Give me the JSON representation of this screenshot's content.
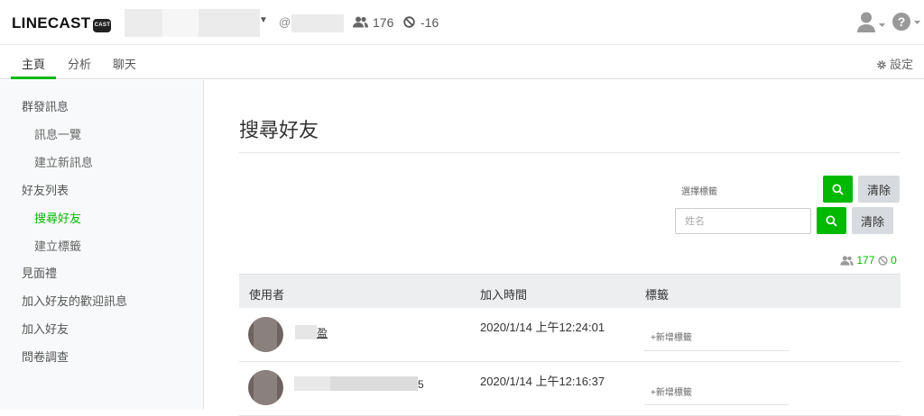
{
  "header": {
    "logo": "LINECAST",
    "logo_badge": "CAST",
    "account_at": "@",
    "friends_count": "176",
    "blocked_count": "-16"
  },
  "tabs": [
    {
      "label": "主頁",
      "active": true
    },
    {
      "label": "分析",
      "active": false
    },
    {
      "label": "聊天",
      "active": false
    }
  ],
  "settings_label": "設定",
  "sidebar": {
    "items": [
      {
        "label": "群發訊息",
        "level": 0
      },
      {
        "label": "訊息一覽",
        "level": 1
      },
      {
        "label": "建立新訊息",
        "level": 1
      },
      {
        "label": "好友列表",
        "level": 0
      },
      {
        "label": "搜尋好友",
        "level": 1,
        "active": true
      },
      {
        "label": "建立標籤",
        "level": 1
      },
      {
        "label": "見面禮",
        "level": 0
      },
      {
        "label": "加入好友的歡迎訊息",
        "level": 0
      },
      {
        "label": "加入好友",
        "level": 0
      },
      {
        "label": "問卷調查",
        "level": 0
      }
    ]
  },
  "main": {
    "title": "搜尋好友",
    "tag_select_label": "選擇標籤",
    "clear_label": "清除",
    "name_placeholder": "姓名",
    "stats_friends": "177",
    "stats_blocked": "0",
    "columns": [
      "使用者",
      "加入時間",
      "標籤"
    ],
    "rows": [
      {
        "name_suffix": "盈",
        "joined": "2020/1/14 上午12:24:01",
        "add_tag": "+新增標籤"
      },
      {
        "name_suffix": "5",
        "joined": "2020/1/14 上午12:16:37",
        "add_tag": "+新增標籤"
      }
    ]
  },
  "colors": {
    "accent": "#00b900",
    "gray_button": "#d7dade"
  }
}
